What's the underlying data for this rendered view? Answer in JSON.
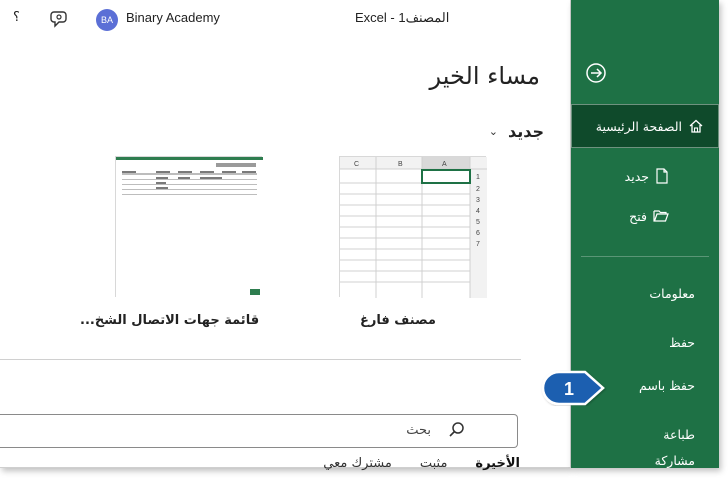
{
  "topbar": {
    "help": "؟",
    "user_initials": "BA",
    "user_name": "Binary Academy",
    "doc_title": "Excel - المصنف1"
  },
  "greeting": "مساء الخير",
  "new_section": {
    "title": "جديد",
    "templates": [
      {
        "label": "مصنف فارغ",
        "icon": "blank-workbook-thumb"
      },
      {
        "label": "قائمة جهات الاتصال الشخ...",
        "icon": "contact-list-thumb"
      }
    ]
  },
  "search": {
    "placeholder": "بحث"
  },
  "tabs": [
    "الأخيرة",
    "مثبت",
    "مشترك معي"
  ],
  "sidebar": {
    "items": [
      {
        "label": "الصفحة الرئيسية",
        "icon": "home-icon",
        "active": true
      },
      {
        "label": "جديد",
        "icon": "new-file-icon"
      },
      {
        "label": "فتح",
        "icon": "open-folder-icon"
      },
      {
        "label": "معلومات"
      },
      {
        "label": "حفظ"
      },
      {
        "label": "حفظ باسم"
      },
      {
        "label": "طباعة"
      },
      {
        "label": "مشاركة"
      }
    ]
  },
  "callout": {
    "number": "1"
  },
  "colors": {
    "sidebar": "#1e7145",
    "active_item": "#0f4a2b",
    "callout": "#1d5fb0",
    "avatar": "#5b6fd6"
  }
}
